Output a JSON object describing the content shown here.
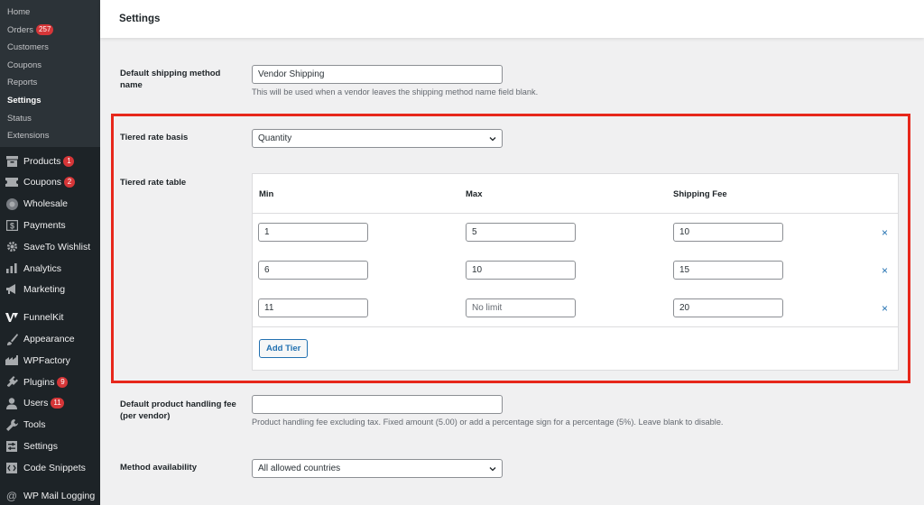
{
  "sidebar": {
    "submenu": [
      {
        "label": "Home"
      },
      {
        "label": "Orders",
        "badge": "257"
      },
      {
        "label": "Customers"
      },
      {
        "label": "Coupons"
      },
      {
        "label": "Reports"
      },
      {
        "label": "Settings",
        "current": true
      },
      {
        "label": "Status"
      },
      {
        "label": "Extensions"
      }
    ],
    "menu": [
      {
        "label": "Products",
        "badge": "1",
        "icon": "archive-icon"
      },
      {
        "label": "Coupons",
        "badge": "2",
        "icon": "ticket-icon"
      },
      {
        "label": "Wholesale",
        "icon": "wholesale-icon"
      },
      {
        "label": "Payments",
        "icon": "dollar-icon"
      },
      {
        "label": "SaveTo Wishlist",
        "icon": "gear-icon"
      },
      {
        "label": "Analytics",
        "icon": "bar-chart-icon"
      },
      {
        "label": "Marketing",
        "icon": "megaphone-icon"
      },
      {
        "label": "FunnelKit",
        "icon": "funnelkit-icon"
      },
      {
        "label": "Appearance",
        "icon": "brush-icon"
      },
      {
        "label": "WPFactory",
        "icon": "factory-icon"
      },
      {
        "label": "Plugins",
        "badge": "9",
        "icon": "plug-icon"
      },
      {
        "label": "Users",
        "badge": "11",
        "icon": "user-icon"
      },
      {
        "label": "Tools",
        "icon": "wrench-icon"
      },
      {
        "label": "Settings",
        "icon": "settings-icon"
      },
      {
        "label": "Code Snippets",
        "icon": "code-icon"
      },
      {
        "label": "WP Mail Logging",
        "icon": "at-icon"
      }
    ]
  },
  "header": {
    "title": "Settings"
  },
  "form": {
    "default_method": {
      "label": "Default shipping method name",
      "value": "Vendor Shipping",
      "description": "This will be used when a vendor leaves the shipping method name field blank."
    },
    "tiered_basis": {
      "label": "Tiered rate basis",
      "value": "Quantity"
    },
    "tiered_table": {
      "label": "Tiered rate table",
      "headers": [
        "Min",
        "Max",
        "Shipping Fee"
      ],
      "rows": [
        {
          "min": "1",
          "max": "5",
          "fee": "10",
          "max_placeholder": ""
        },
        {
          "min": "6",
          "max": "10",
          "fee": "15",
          "max_placeholder": ""
        },
        {
          "min": "11",
          "max": "",
          "fee": "20",
          "max_placeholder": "No limit"
        }
      ],
      "remove_symbol": "×",
      "add_label": "Add Tier"
    },
    "handling_fee": {
      "label": "Default product handling fee (per vendor)",
      "value": "",
      "description": "Product handling fee excluding tax. Fixed amount (5.00) or add a percentage sign for a percentage (5%). Leave blank to disable."
    },
    "availability": {
      "label": "Method availability",
      "value": "All allowed countries"
    }
  },
  "colors": {
    "accent": "#2271b1",
    "highlight": "#e7271b",
    "badge": "#d63638",
    "sidebar": "#1d2327"
  }
}
